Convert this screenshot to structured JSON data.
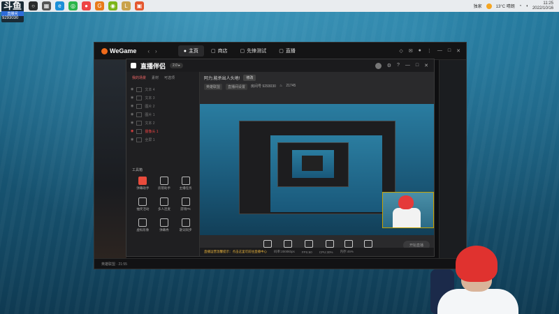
{
  "streamer": {
    "logo": "斗鱼",
    "tag": "直播间",
    "room_id": "9293030"
  },
  "taskbar": {
    "apps": [
      {
        "name": "start-icon",
        "color": "#2b2b2b",
        "glyph": "○"
      },
      {
        "name": "taskview-icon",
        "color": "#555",
        "glyph": "▦"
      },
      {
        "name": "edge-icon",
        "color": "#1b8fd8",
        "glyph": "e"
      },
      {
        "name": "wechat-icon",
        "color": "#2ab54a",
        "glyph": "◎"
      },
      {
        "name": "chrome-icon",
        "color": "#e44",
        "glyph": "●"
      },
      {
        "name": "wegame-icon",
        "color": "#e87a19",
        "glyph": "G"
      },
      {
        "name": "green-app-icon",
        "color": "#7cb518",
        "glyph": "◉"
      },
      {
        "name": "lol-icon",
        "color": "#c9a24a",
        "glyph": "L"
      },
      {
        "name": "live-app-icon",
        "color": "#e4572e",
        "glyph": "▣"
      }
    ],
    "tray_label": "独家",
    "weather": "13°C 晴朗",
    "time": "11:25",
    "date": "2022/10/16"
  },
  "wegame": {
    "logo": "WeGame",
    "tabs": [
      {
        "label": "主页",
        "icon": "home-icon",
        "active": true
      },
      {
        "label": "商店",
        "icon": "store-icon",
        "active": false
      },
      {
        "label": "先锋测试",
        "icon": "test-icon",
        "active": false
      },
      {
        "label": "直播",
        "icon": "live-icon",
        "active": false
      }
    ],
    "bottom_strip": "英雄联盟 · 21:55"
  },
  "companion": {
    "logo": "直播伴侣",
    "badge": "2.0 ▸",
    "left_tabs": [
      "我的场景",
      "素材",
      "可选项"
    ],
    "scenes": [
      {
        "label": "文本 4",
        "active": false
      },
      {
        "label": "文本 3",
        "active": false
      },
      {
        "label": "图片 2",
        "active": false
      },
      {
        "label": "图片 1",
        "active": false
      },
      {
        "label": "文本 2",
        "active": false
      },
      {
        "label": "摄像头 1",
        "active": true
      },
      {
        "label": "全屏 1",
        "active": false
      }
    ],
    "tools_title": "工具箱",
    "tools": [
      {
        "label": "弹幕助手",
        "highlight": true
      },
      {
        "label": "房管助手",
        "highlight": false
      },
      {
        "label": "主播任务",
        "highlight": false
      },
      {
        "label": "抽奖活动",
        "highlight": false
      },
      {
        "label": "多人连麦",
        "highlight": false
      },
      {
        "label": "游戏PK",
        "highlight": false
      },
      {
        "label": "虚拟形象",
        "highlight": false
      },
      {
        "label": "弹幕秀",
        "highlight": false
      },
      {
        "label": "歌词同步",
        "highlight": false
      }
    ],
    "title": "阿力,能杀出人头地!",
    "title_edit": "修改",
    "category": "英雄联盟",
    "sub_tag": "直播间设置",
    "room_info": "房间号 9293030",
    "viewer_count": "21745",
    "actions": [
      {
        "label": "直播屏幕",
        "icon": "screen-icon"
      },
      {
        "label": "摄像头",
        "icon": "camera-icon"
      },
      {
        "label": "手机投屏",
        "icon": "phone-icon"
      },
      {
        "label": "多媒体",
        "icon": "media-icon"
      },
      {
        "label": "麦克风",
        "icon": "mic-icon"
      },
      {
        "label": "扬声器",
        "icon": "speaker-icon"
      }
    ],
    "start_button": "开始直播",
    "status_warning": "直播运营温馨提示：点击这里可前往直播中心",
    "status_items": [
      "码率:2000kbps",
      "FPS:60",
      "CPU:30%",
      "内存:45%"
    ]
  }
}
